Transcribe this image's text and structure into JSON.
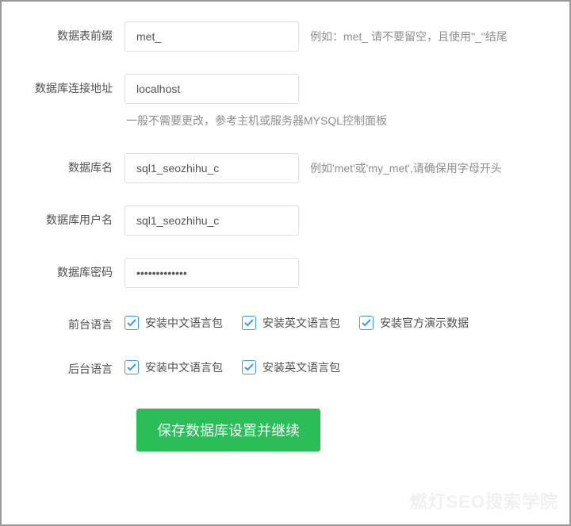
{
  "fields": {
    "table_prefix": {
      "label": "数据表前缀",
      "value": "met_",
      "hint": "例如：met_ 请不要留空，且使用\"_\"结尾"
    },
    "db_host": {
      "label": "数据库连接地址",
      "value": "localhost",
      "hint_below": "一般不需要更改，参考主机或服务器MYSQL控制面板"
    },
    "db_name": {
      "label": "数据库名",
      "value": "sql1_seozhihu_c",
      "hint": "例如'met'或'my_met',请确保用字母开头"
    },
    "db_user": {
      "label": "数据库用户名",
      "value": "sql1_seozhihu_c"
    },
    "db_password": {
      "label": "数据库密码",
      "value": "•••••••••••••"
    },
    "front_lang": {
      "label": "前台语言",
      "options": [
        "安装中文语言包",
        "安装英文语言包",
        "安装官方演示数据"
      ]
    },
    "back_lang": {
      "label": "后台语言",
      "options": [
        "安装中文语言包",
        "安装英文语言包"
      ]
    }
  },
  "submit_label": "保存数据库设置并继续",
  "watermark": "燃灯SEO搜索学院"
}
